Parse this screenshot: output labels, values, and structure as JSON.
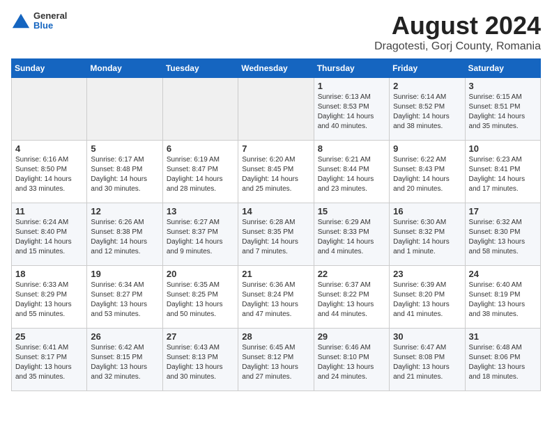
{
  "logo": {
    "general": "General",
    "blue": "Blue"
  },
  "title": "August 2024",
  "location": "Dragotesti, Gorj County, Romania",
  "weekdays": [
    "Sunday",
    "Monday",
    "Tuesday",
    "Wednesday",
    "Thursday",
    "Friday",
    "Saturday"
  ],
  "weeks": [
    [
      {
        "day": "",
        "info": ""
      },
      {
        "day": "",
        "info": ""
      },
      {
        "day": "",
        "info": ""
      },
      {
        "day": "",
        "info": ""
      },
      {
        "day": "1",
        "info": "Sunrise: 6:13 AM\nSunset: 8:53 PM\nDaylight: 14 hours\nand 40 minutes."
      },
      {
        "day": "2",
        "info": "Sunrise: 6:14 AM\nSunset: 8:52 PM\nDaylight: 14 hours\nand 38 minutes."
      },
      {
        "day": "3",
        "info": "Sunrise: 6:15 AM\nSunset: 8:51 PM\nDaylight: 14 hours\nand 35 minutes."
      }
    ],
    [
      {
        "day": "4",
        "info": "Sunrise: 6:16 AM\nSunset: 8:50 PM\nDaylight: 14 hours\nand 33 minutes."
      },
      {
        "day": "5",
        "info": "Sunrise: 6:17 AM\nSunset: 8:48 PM\nDaylight: 14 hours\nand 30 minutes."
      },
      {
        "day": "6",
        "info": "Sunrise: 6:19 AM\nSunset: 8:47 PM\nDaylight: 14 hours\nand 28 minutes."
      },
      {
        "day": "7",
        "info": "Sunrise: 6:20 AM\nSunset: 8:45 PM\nDaylight: 14 hours\nand 25 minutes."
      },
      {
        "day": "8",
        "info": "Sunrise: 6:21 AM\nSunset: 8:44 PM\nDaylight: 14 hours\nand 23 minutes."
      },
      {
        "day": "9",
        "info": "Sunrise: 6:22 AM\nSunset: 8:43 PM\nDaylight: 14 hours\nand 20 minutes."
      },
      {
        "day": "10",
        "info": "Sunrise: 6:23 AM\nSunset: 8:41 PM\nDaylight: 14 hours\nand 17 minutes."
      }
    ],
    [
      {
        "day": "11",
        "info": "Sunrise: 6:24 AM\nSunset: 8:40 PM\nDaylight: 14 hours\nand 15 minutes."
      },
      {
        "day": "12",
        "info": "Sunrise: 6:26 AM\nSunset: 8:38 PM\nDaylight: 14 hours\nand 12 minutes."
      },
      {
        "day": "13",
        "info": "Sunrise: 6:27 AM\nSunset: 8:37 PM\nDaylight: 14 hours\nand 9 minutes."
      },
      {
        "day": "14",
        "info": "Sunrise: 6:28 AM\nSunset: 8:35 PM\nDaylight: 14 hours\nand 7 minutes."
      },
      {
        "day": "15",
        "info": "Sunrise: 6:29 AM\nSunset: 8:33 PM\nDaylight: 14 hours\nand 4 minutes."
      },
      {
        "day": "16",
        "info": "Sunrise: 6:30 AM\nSunset: 8:32 PM\nDaylight: 14 hours\nand 1 minute."
      },
      {
        "day": "17",
        "info": "Sunrise: 6:32 AM\nSunset: 8:30 PM\nDaylight: 13 hours\nand 58 minutes."
      }
    ],
    [
      {
        "day": "18",
        "info": "Sunrise: 6:33 AM\nSunset: 8:29 PM\nDaylight: 13 hours\nand 55 minutes."
      },
      {
        "day": "19",
        "info": "Sunrise: 6:34 AM\nSunset: 8:27 PM\nDaylight: 13 hours\nand 53 minutes."
      },
      {
        "day": "20",
        "info": "Sunrise: 6:35 AM\nSunset: 8:25 PM\nDaylight: 13 hours\nand 50 minutes."
      },
      {
        "day": "21",
        "info": "Sunrise: 6:36 AM\nSunset: 8:24 PM\nDaylight: 13 hours\nand 47 minutes."
      },
      {
        "day": "22",
        "info": "Sunrise: 6:37 AM\nSunset: 8:22 PM\nDaylight: 13 hours\nand 44 minutes."
      },
      {
        "day": "23",
        "info": "Sunrise: 6:39 AM\nSunset: 8:20 PM\nDaylight: 13 hours\nand 41 minutes."
      },
      {
        "day": "24",
        "info": "Sunrise: 6:40 AM\nSunset: 8:19 PM\nDaylight: 13 hours\nand 38 minutes."
      }
    ],
    [
      {
        "day": "25",
        "info": "Sunrise: 6:41 AM\nSunset: 8:17 PM\nDaylight: 13 hours\nand 35 minutes."
      },
      {
        "day": "26",
        "info": "Sunrise: 6:42 AM\nSunset: 8:15 PM\nDaylight: 13 hours\nand 32 minutes."
      },
      {
        "day": "27",
        "info": "Sunrise: 6:43 AM\nSunset: 8:13 PM\nDaylight: 13 hours\nand 30 minutes."
      },
      {
        "day": "28",
        "info": "Sunrise: 6:45 AM\nSunset: 8:12 PM\nDaylight: 13 hours\nand 27 minutes."
      },
      {
        "day": "29",
        "info": "Sunrise: 6:46 AM\nSunset: 8:10 PM\nDaylight: 13 hours\nand 24 minutes."
      },
      {
        "day": "30",
        "info": "Sunrise: 6:47 AM\nSunset: 8:08 PM\nDaylight: 13 hours\nand 21 minutes."
      },
      {
        "day": "31",
        "info": "Sunrise: 6:48 AM\nSunset: 8:06 PM\nDaylight: 13 hours\nand 18 minutes."
      }
    ]
  ]
}
